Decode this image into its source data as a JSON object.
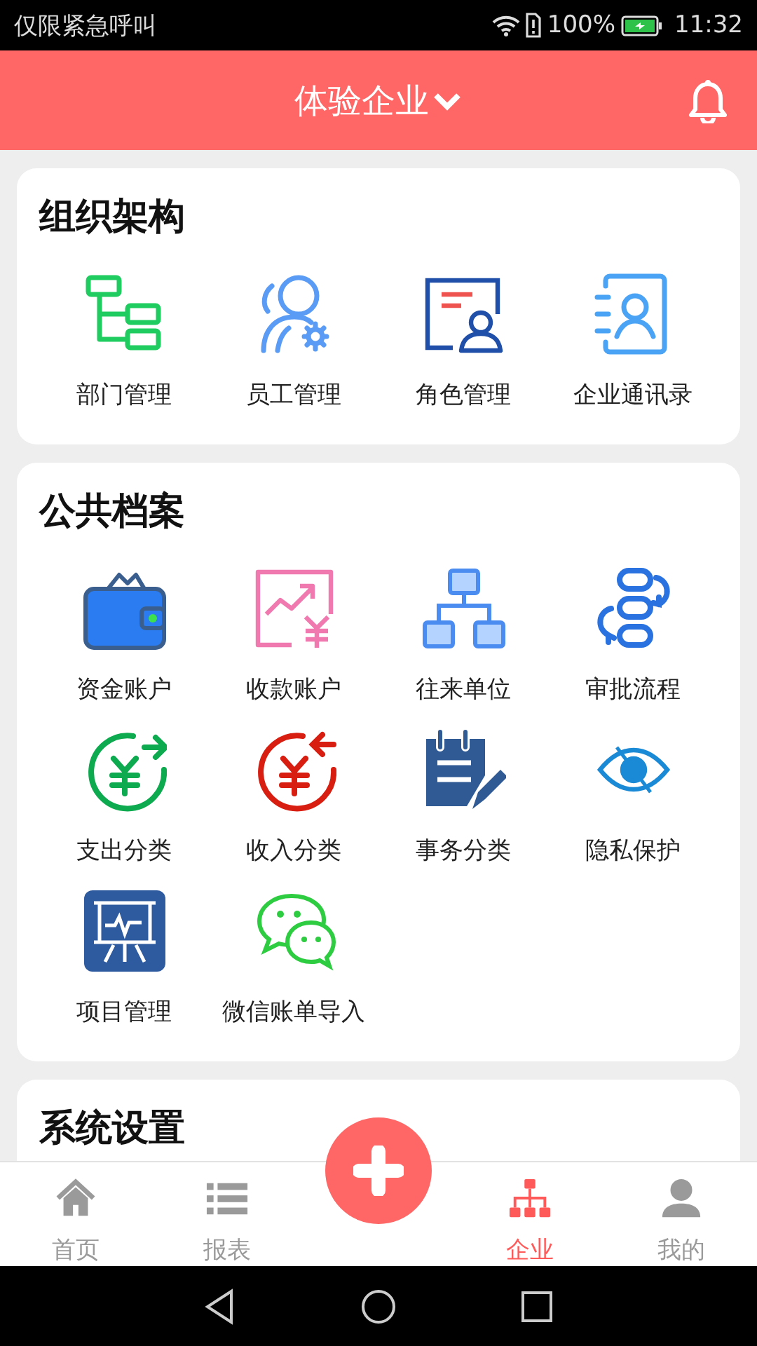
{
  "status_bar": {
    "carrier": "仅限紧急呼叫",
    "battery": "100%",
    "time": "11:32"
  },
  "header": {
    "title": "体验企业"
  },
  "sections": [
    {
      "title": "组织架构",
      "items": [
        {
          "label": "部门管理"
        },
        {
          "label": "员工管理"
        },
        {
          "label": "角色管理"
        },
        {
          "label": "企业通讯录"
        }
      ]
    },
    {
      "title": "公共档案",
      "items": [
        {
          "label": "资金账户"
        },
        {
          "label": "收款账户"
        },
        {
          "label": "往来单位"
        },
        {
          "label": "审批流程"
        },
        {
          "label": "支出分类"
        },
        {
          "label": "收入分类"
        },
        {
          "label": "事务分类"
        },
        {
          "label": "隐私保护"
        },
        {
          "label": "项目管理"
        },
        {
          "label": "微信账单导入"
        }
      ]
    },
    {
      "title": "系统设置"
    }
  ],
  "tabs": [
    {
      "label": "首页",
      "selected": false
    },
    {
      "label": "报表",
      "selected": false
    },
    {
      "label": "企业",
      "selected": true
    },
    {
      "label": "我的",
      "selected": false
    }
  ]
}
